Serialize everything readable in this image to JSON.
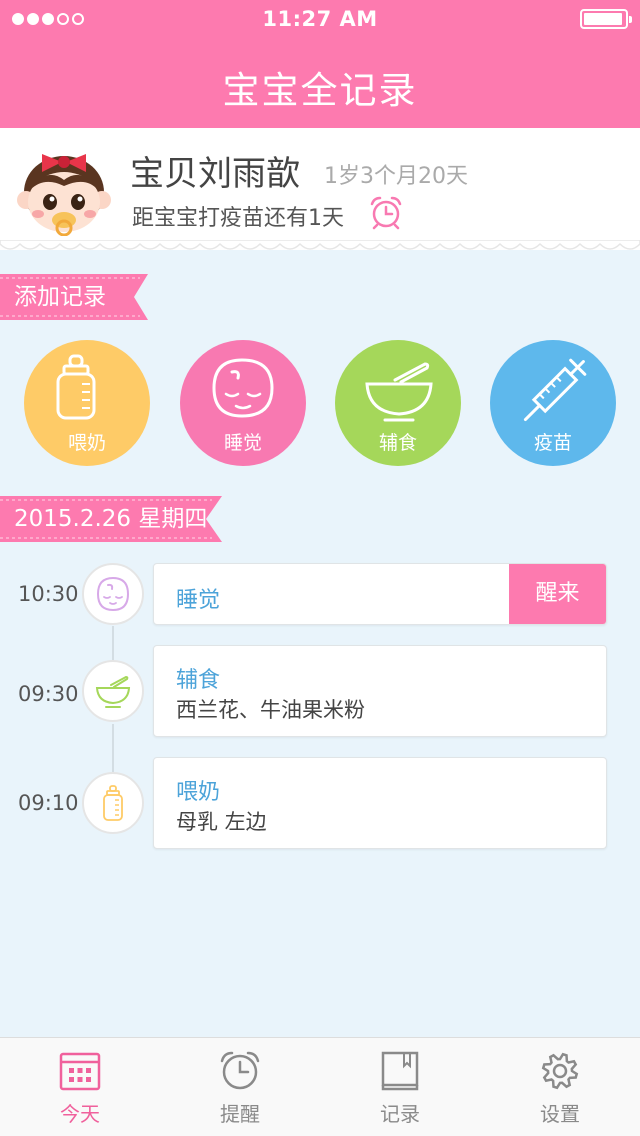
{
  "status_bar": {
    "signal_filled": 3,
    "signal_total": 5,
    "time": "11:27  AM",
    "battery_level": 0.95
  },
  "header": {
    "title": "宝宝全记录"
  },
  "profile": {
    "name": "宝贝刘雨歆",
    "age": "1岁3个月20天",
    "vaccine_note": "距宝宝打疫苗还有1天",
    "avatar_icon": "baby-girl-avatar-icon",
    "alarm_icon": "alarm-clock-icon"
  },
  "add_section": {
    "title": "添加记录",
    "buttons": [
      {
        "label": "喂奶",
        "icon": "baby-bottle-icon",
        "color": "#fecb67"
      },
      {
        "label": "睡觉",
        "icon": "sleeping-baby-icon",
        "color": "#f879b1"
      },
      {
        "label": "辅食",
        "icon": "food-bowl-icon",
        "color": "#a5d75a"
      },
      {
        "label": "疫苗",
        "icon": "syringe-icon",
        "color": "#5eb8ec"
      }
    ]
  },
  "timeline": {
    "date": "2015.2.26 星期四",
    "entries": [
      {
        "time": "10:30",
        "title": "睡觉",
        "detail": "",
        "action": "醒来",
        "icon": "sleeping-baby-icon",
        "icon_color": "#d7a9e8"
      },
      {
        "time": "09:30",
        "title": "辅食",
        "detail": "西兰花、牛油果米粉",
        "icon": "food-bowl-icon",
        "icon_color": "#a5d75a"
      },
      {
        "time": "09:10",
        "title": "喂奶",
        "detail": "母乳 左边",
        "icon": "baby-bottle-icon",
        "icon_color": "#fecb67"
      }
    ]
  },
  "tabbar": {
    "tabs": [
      {
        "label": "今天",
        "icon": "calendar-icon",
        "active": true
      },
      {
        "label": "提醒",
        "icon": "alarm-clock-icon",
        "active": false
      },
      {
        "label": "记录",
        "icon": "record-book-icon",
        "active": false
      },
      {
        "label": "设置",
        "icon": "gear-icon",
        "active": false
      }
    ]
  },
  "colors": {
    "brand_pink": "#fd7aaf",
    "background": "#e9f4fb",
    "card_title_blue": "#4ca3d9",
    "tab_active": "#f0609c",
    "tab_inactive": "#8a8a8a"
  }
}
